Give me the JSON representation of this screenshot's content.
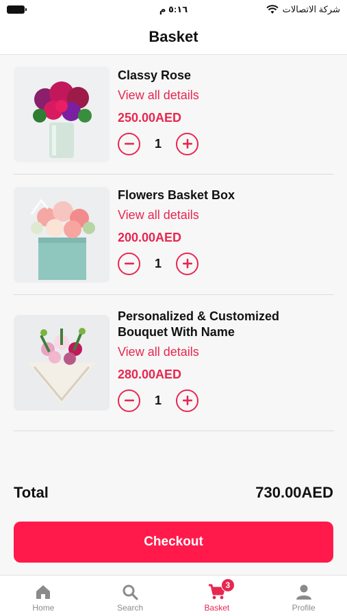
{
  "status_bar": {
    "time": "٥:١٦ م",
    "carrier": "شركة الاتصالات"
  },
  "header": {
    "title": "Basket"
  },
  "items": [
    {
      "name_lines": [
        "Classy Rose"
      ],
      "details_label": "View all details",
      "price": "250.00AED",
      "quantity": "1",
      "image_icon": "flower-vase-image"
    },
    {
      "name_lines": [
        "Flowers Basket Box"
      ],
      "details_label": "View all details",
      "price": "200.00AED",
      "quantity": "1",
      "image_icon": "flower-box-image"
    },
    {
      "name_lines": [
        "Personalized & Customized",
        "Bouquet With Name"
      ],
      "details_label": "View all details",
      "price": "280.00AED",
      "quantity": "1",
      "image_icon": "bouquet-image"
    }
  ],
  "total": {
    "label": "Total",
    "value": "730.00AED"
  },
  "checkout": {
    "label": "Checkout"
  },
  "tab_bar": {
    "tabs": [
      {
        "label": "Home",
        "icon": "home-icon"
      },
      {
        "label": "Search",
        "icon": "search-icon"
      },
      {
        "label": "Basket",
        "icon": "cart-icon",
        "badge": "3",
        "active": true
      },
      {
        "label": "Profile",
        "icon": "profile-icon"
      }
    ]
  },
  "colors": {
    "accent": "#e8264f",
    "checkout": "#ff1a4b"
  }
}
